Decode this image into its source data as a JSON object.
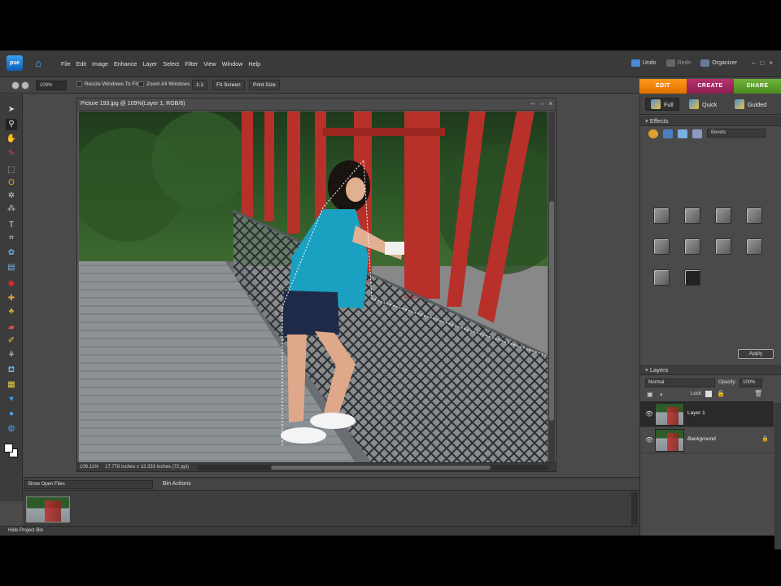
{
  "menubar": {
    "logo": "pse",
    "menus": [
      "File",
      "Edit",
      "Image",
      "Enhance",
      "Layer",
      "Select",
      "Filter",
      "View",
      "Window",
      "Help"
    ],
    "undo": "Undo",
    "redo": "Redo",
    "organizer": "Organizer",
    "win_min": "–",
    "win_max": "□",
    "win_close": "×"
  },
  "options": {
    "zoom": "109%",
    "resize_windows": "Resize Windows To Fit",
    "zoom_all": "Zoom All Windows",
    "one_to_one": "1:1",
    "fit_screen": "Fit Screen",
    "print_size": "Print Size"
  },
  "mode_tabs": {
    "edit": "EDIT",
    "create": "CREATE",
    "share": "SHARE"
  },
  "view_tabs": {
    "full": "Full",
    "quick": "Quick",
    "guided": "Guided"
  },
  "document": {
    "title": "Picture 193.jpg @ 109%(Layer 1, RGB/8)",
    "status_zoom": "109.11%",
    "status_size": "17.778 inches x 13.333 inches (72 ppi)"
  },
  "effects": {
    "header": "Effects",
    "category": "Bevels",
    "apply": "Apply"
  },
  "layers": {
    "header": "Layers",
    "blend_mode": "Normal",
    "opacity_label": "Opacity:",
    "opacity": "100%",
    "lock_label": "Lock:",
    "items": [
      {
        "name": "Layer 1"
      },
      {
        "name": "Background"
      }
    ]
  },
  "bin": {
    "show": "Show Open Files",
    "actions": "Bin Actions",
    "hide": "Hide Project Bin"
  },
  "colors": {
    "edit_tab": "#f08a10",
    "create_tab": "#a62a62",
    "share_tab": "#5fa02e"
  }
}
